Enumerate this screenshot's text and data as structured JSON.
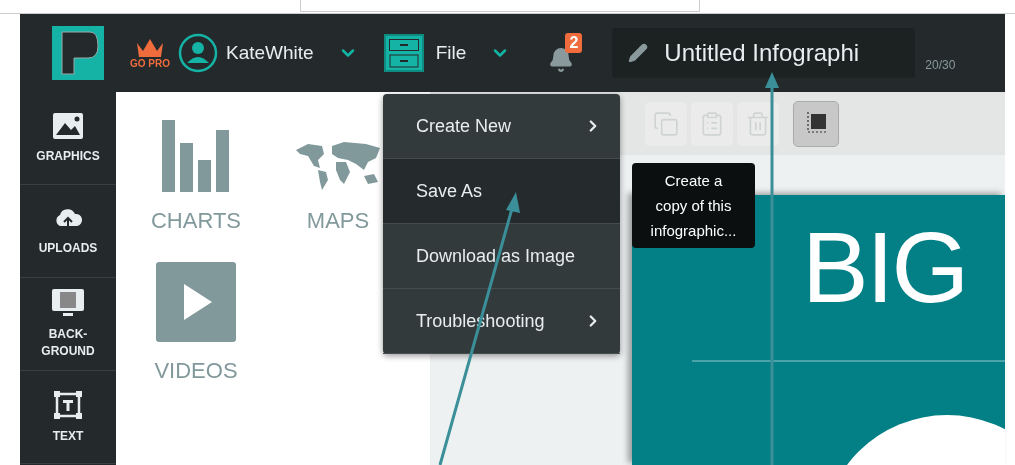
{
  "header": {
    "go_pro": "GO PRO",
    "user": "KateWhite",
    "file": "File",
    "notifications": "2",
    "title": "Untitled Infographi",
    "page_count": "20/30"
  },
  "sidebar": {
    "items": [
      {
        "label": "GRAPHICS",
        "kind": "graphics"
      },
      {
        "label": "UPLOADS",
        "kind": "uploads"
      },
      {
        "label": "BACK-GROUND",
        "kind": "background"
      },
      {
        "label": "TEXT",
        "kind": "text"
      }
    ]
  },
  "panel": {
    "items": [
      {
        "label": "CHARTS",
        "kind": "charts"
      },
      {
        "label": "MAPS",
        "kind": "maps"
      },
      {
        "label": "VIDEOS",
        "kind": "videos"
      }
    ]
  },
  "file_menu": {
    "items": [
      {
        "label": "Create New",
        "submenu": true,
        "selected": false
      },
      {
        "label": "Save As",
        "submenu": false,
        "selected": true
      },
      {
        "label": "Download as Image",
        "submenu": false,
        "selected": false
      },
      {
        "label": "Troubleshooting",
        "submenu": true,
        "selected": false
      }
    ]
  },
  "tooltip": "Create a copy of this infographic...",
  "toolbar": {
    "items": [
      {
        "kind": "copy",
        "disabled": true
      },
      {
        "kind": "paste",
        "disabled": true
      },
      {
        "kind": "delete",
        "disabled": true
      },
      {
        "kind": "position",
        "disabled": false
      }
    ]
  },
  "canvas": {
    "heading": "BIG"
  }
}
